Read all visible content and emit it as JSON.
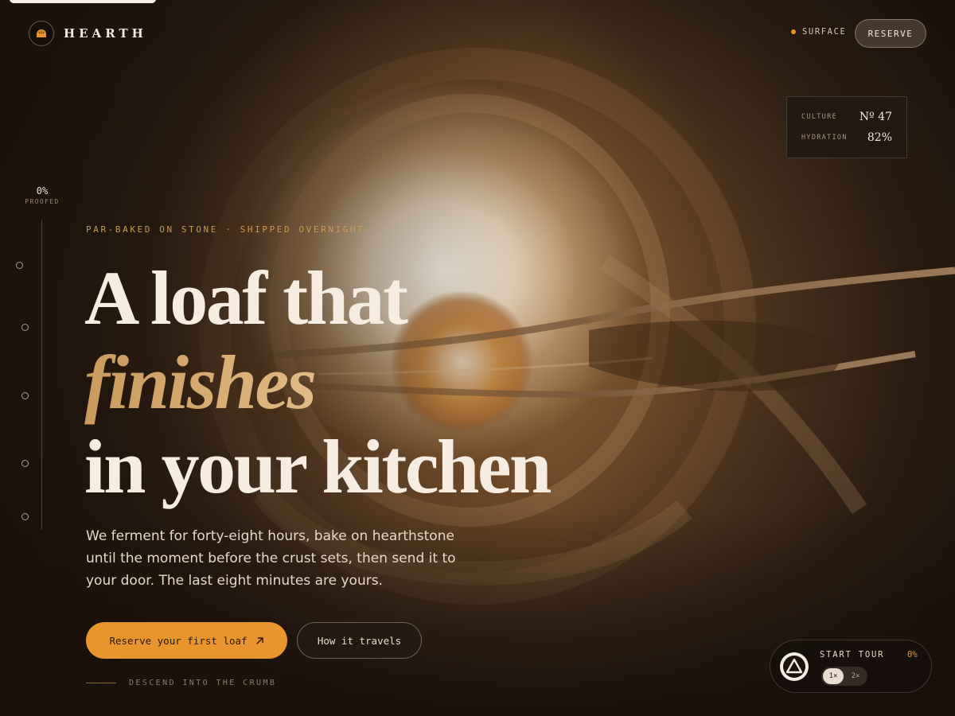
{
  "brand": {
    "name": "HEARTH",
    "icon": "bread-icon"
  },
  "nav": {
    "status_label": "SURFACE",
    "reserve_label": "RESERVE",
    "accent": "#e8952e"
  },
  "stats": [
    {
      "label": "CULTURE",
      "value": "Nº 47"
    },
    {
      "label": "HYDRATION",
      "value": "82%"
    }
  ],
  "progress": {
    "value": "0%",
    "label": "PROOFED",
    "steps": 5
  },
  "hero": {
    "eyebrow": "PAR-BAKED ON STONE · SHIPPED OVERNIGHT",
    "headline_line1": "A loaf that",
    "headline_accent": "finishes",
    "headline_line3": "in your kitchen",
    "body": "We ferment for forty-eight hours, bake on hearthstone until the moment before the crust sets, then send it to your door. The last eight minutes are yours.",
    "cta_primary": "Reserve your first loaf",
    "cta_secondary": "How it travels",
    "scroll_hint": "DESCEND INTO THE CRUMB"
  },
  "tour": {
    "label": "START TOUR",
    "progress": "0%",
    "speeds": [
      "1×",
      "2×"
    ],
    "selected_speed": "1×"
  },
  "colors": {
    "background": "#1a120b",
    "accent": "#e8952e",
    "accent_text": "#c89a55",
    "text": "#f3e9dc"
  }
}
